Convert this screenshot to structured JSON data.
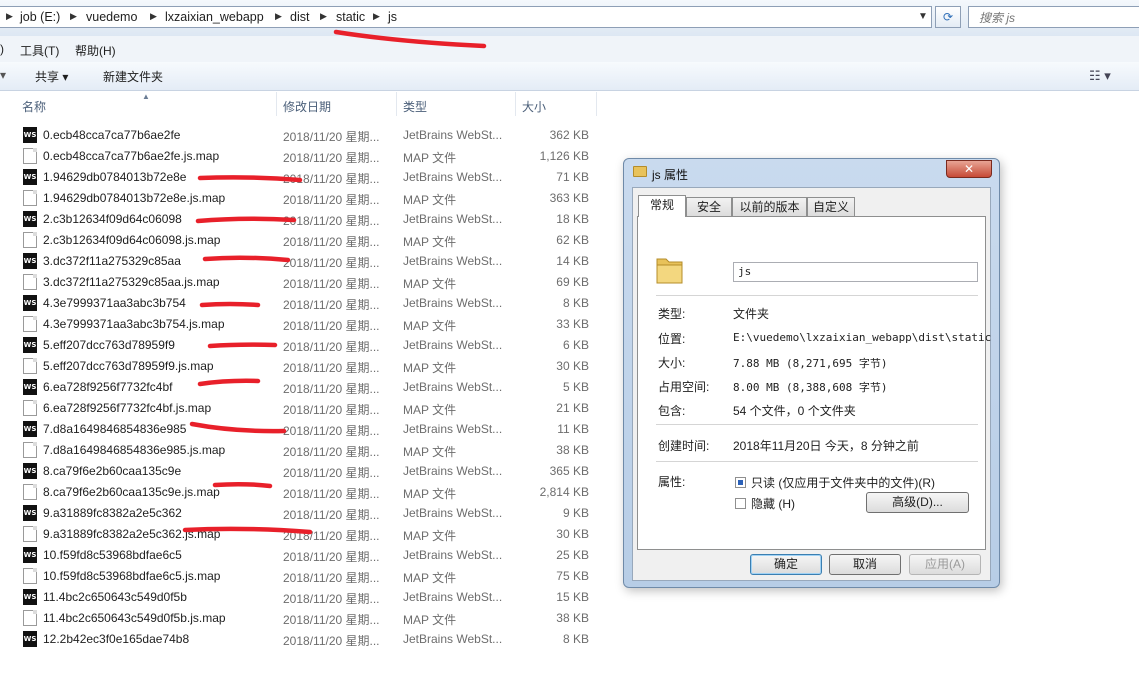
{
  "address_bar": {
    "crumbs": [
      "job (E:)",
      "vuedemo",
      "lxzaixian_webapp",
      "dist",
      "static",
      "js"
    ],
    "search_placeholder": "搜索 js"
  },
  "menu": {
    "tools": "工具(T)",
    "help": "帮助(H)",
    "left_fragment": ")"
  },
  "toolbar": {
    "share": "共享 ▾",
    "new_folder": "新建文件夹"
  },
  "columns": {
    "name": "名称",
    "date": "修改日期",
    "type": "类型",
    "size": "大小"
  },
  "files": [
    {
      "name": "0.ecb48cca7ca77b6ae2fe",
      "date": "2018/11/20 星期...",
      "type": "JetBrains WebSt...",
      "size": "362 KB",
      "icon": "ws"
    },
    {
      "name": "0.ecb48cca7ca77b6ae2fe.js.map",
      "date": "2018/11/20 星期...",
      "type": "MAP 文件",
      "size": "1,126 KB",
      "icon": "map"
    },
    {
      "name": "1.94629db0784013b72e8e",
      "date": "2018/11/20 星期...",
      "type": "JetBrains WebSt...",
      "size": "71 KB",
      "icon": "ws"
    },
    {
      "name": "1.94629db0784013b72e8e.js.map",
      "date": "2018/11/20 星期...",
      "type": "MAP 文件",
      "size": "363 KB",
      "icon": "map"
    },
    {
      "name": "2.c3b12634f09d64c06098",
      "date": "2018/11/20 星期...",
      "type": "JetBrains WebSt...",
      "size": "18 KB",
      "icon": "ws"
    },
    {
      "name": "2.c3b12634f09d64c06098.js.map",
      "date": "2018/11/20 星期...",
      "type": "MAP 文件",
      "size": "62 KB",
      "icon": "map"
    },
    {
      "name": "3.dc372f11a275329c85aa",
      "date": "2018/11/20 星期...",
      "type": "JetBrains WebSt...",
      "size": "14 KB",
      "icon": "ws"
    },
    {
      "name": "3.dc372f11a275329c85aa.js.map",
      "date": "2018/11/20 星期...",
      "type": "MAP 文件",
      "size": "69 KB",
      "icon": "map"
    },
    {
      "name": "4.3e7999371aa3abc3b754",
      "date": "2018/11/20 星期...",
      "type": "JetBrains WebSt...",
      "size": "8 KB",
      "icon": "ws"
    },
    {
      "name": "4.3e7999371aa3abc3b754.js.map",
      "date": "2018/11/20 星期...",
      "type": "MAP 文件",
      "size": "33 KB",
      "icon": "map"
    },
    {
      "name": "5.eff207dcc763d78959f9",
      "date": "2018/11/20 星期...",
      "type": "JetBrains WebSt...",
      "size": "6 KB",
      "icon": "ws"
    },
    {
      "name": "5.eff207dcc763d78959f9.js.map",
      "date": "2018/11/20 星期...",
      "type": "MAP 文件",
      "size": "30 KB",
      "icon": "map"
    },
    {
      "name": "6.ea728f9256f7732fc4bf",
      "date": "2018/11/20 星期...",
      "type": "JetBrains WebSt...",
      "size": "5 KB",
      "icon": "ws"
    },
    {
      "name": "6.ea728f9256f7732fc4bf.js.map",
      "date": "2018/11/20 星期...",
      "type": "MAP 文件",
      "size": "21 KB",
      "icon": "map"
    },
    {
      "name": "7.d8a1649846854836e985",
      "date": "2018/11/20 星期...",
      "type": "JetBrains WebSt...",
      "size": "11 KB",
      "icon": "ws"
    },
    {
      "name": "7.d8a1649846854836e985.js.map",
      "date": "2018/11/20 星期...",
      "type": "MAP 文件",
      "size": "38 KB",
      "icon": "map"
    },
    {
      "name": "8.ca79f6e2b60caa135c9e",
      "date": "2018/11/20 星期...",
      "type": "JetBrains WebSt...",
      "size": "365 KB",
      "icon": "ws"
    },
    {
      "name": "8.ca79f6e2b60caa135c9e.js.map",
      "date": "2018/11/20 星期...",
      "type": "MAP 文件",
      "size": "2,814 KB",
      "icon": "map"
    },
    {
      "name": "9.a31889fc8382a2e5c362",
      "date": "2018/11/20 星期...",
      "type": "JetBrains WebSt...",
      "size": "9 KB",
      "icon": "ws"
    },
    {
      "name": "9.a31889fc8382a2e5c362.js.map",
      "date": "2018/11/20 星期...",
      "type": "MAP 文件",
      "size": "30 KB",
      "icon": "map"
    },
    {
      "name": "10.f59fd8c53968bdfae6c5",
      "date": "2018/11/20 星期...",
      "type": "JetBrains WebSt...",
      "size": "25 KB",
      "icon": "ws"
    },
    {
      "name": "10.f59fd8c53968bdfae6c5.js.map",
      "date": "2018/11/20 星期...",
      "type": "MAP 文件",
      "size": "75 KB",
      "icon": "map"
    },
    {
      "name": "11.4bc2c650643c549d0f5b",
      "date": "2018/11/20 星期...",
      "type": "JetBrains WebSt...",
      "size": "15 KB",
      "icon": "ws"
    },
    {
      "name": "11.4bc2c650643c549d0f5b.js.map",
      "date": "2018/11/20 星期...",
      "type": "MAP 文件",
      "size": "38 KB",
      "icon": "map"
    },
    {
      "name": "12.2b42ec3f0e165dae74b8",
      "date": "2018/11/20 星期...",
      "type": "JetBrains WebSt...",
      "size": "8 KB",
      "icon": "ws"
    }
  ],
  "dialog": {
    "title": "js 属性",
    "close": "✕",
    "tabs": [
      "常规",
      "安全",
      "以前的版本",
      "自定义"
    ],
    "folder_name": "js",
    "labels": {
      "type": "类型:",
      "location": "位置:",
      "size": "大小:",
      "size_on_disk": "占用空间:",
      "contains": "包含:",
      "created": "创建时间:",
      "attributes": "属性:"
    },
    "values": {
      "type": "文件夹",
      "location": "E:\\vuedemo\\lxzaixian_webapp\\dist\\static",
      "size": "7.88 MB (8,271,695 字节)",
      "size_on_disk": "8.00 MB (8,388,608 字节)",
      "contains": "54 个文件，0 个文件夹",
      "created": "2018年11月20日 今天，8 分钟之前"
    },
    "readonly_label": "只读 (仅应用于文件夹中的文件)(R)",
    "hidden_label": "隐藏 (H)",
    "advanced_button": "高级(D)...",
    "ok": "确定",
    "cancel": "取消",
    "apply": "应用(A)"
  },
  "colors": {
    "annotation": "#e8202a",
    "ws_icon": "#111111",
    "folder": "#e8c25a"
  }
}
